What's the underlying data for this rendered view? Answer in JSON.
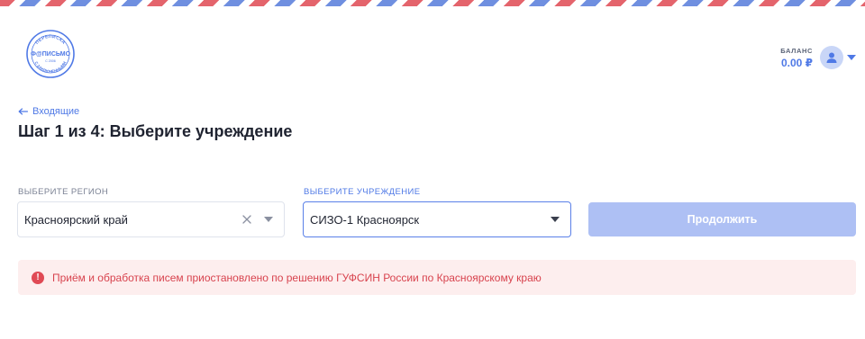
{
  "logo": {
    "top_text": "ПЕРЕПИСКА",
    "main_text": "Ф@ПИСЬМО",
    "since_text": "С 2006",
    "bottom_text": "С ЗАКЛЮЧЁННЫМИ"
  },
  "header": {
    "balance_label": "БАЛАНС",
    "balance_value": "0.00 ₽",
    "avatar_icon": "user-icon",
    "menu_icon": "caret-down-icon"
  },
  "nav": {
    "back_label": "Входящие",
    "back_icon": "arrow-left-icon"
  },
  "page": {
    "title": "Шаг 1 из 4: Выберите учреждение"
  },
  "form": {
    "region_label": "ВЫБЕРИТЕ РЕГИОН",
    "region_value": "Красноярский край",
    "institution_label": "ВЫБЕРИТЕ УЧРЕЖДЕНИЕ",
    "institution_value": "СИЗО-1 Красноярск",
    "continue_label": "Продолжить"
  },
  "alert": {
    "icon": "alert-circle-icon",
    "text": "Приём и обработка писем приостановлено по решению ГУФСИН России по Красноярскому краю"
  },
  "colors": {
    "accent": "#4f79e6",
    "button_disabled": "#aec0f4",
    "alert_bg": "#fdeeee",
    "alert_text": "#d8434e",
    "stripe_red": "#e4646c",
    "stripe_blue": "#6f8fe0"
  }
}
